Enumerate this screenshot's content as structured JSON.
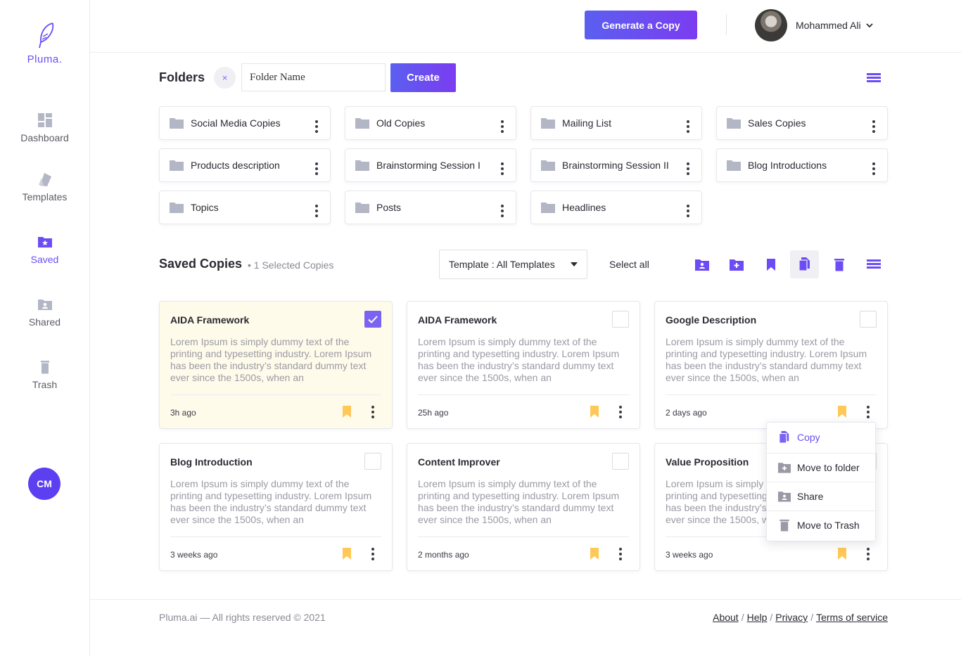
{
  "brand": {
    "name": "Pluma."
  },
  "sidebar": {
    "items": [
      {
        "label": "Dashboard",
        "icon": "dashboard-icon",
        "active": false
      },
      {
        "label": "Templates",
        "icon": "templates-icon",
        "active": false
      },
      {
        "label": "Saved",
        "icon": "saved-folder-icon",
        "active": true
      },
      {
        "label": "Shared",
        "icon": "shared-folder-icon",
        "active": false
      },
      {
        "label": "Trash",
        "icon": "trash-icon",
        "active": false
      }
    ],
    "avatar_initials": "CM"
  },
  "header": {
    "generate_label": "Generate a Copy",
    "user_name": "Mohammed Ali"
  },
  "folders_section": {
    "title": "Folders",
    "clear_label": "×",
    "input_value": "Folder Name",
    "create_label": "Create",
    "folders": [
      {
        "name": "Social Media Copies"
      },
      {
        "name": "Old Copies"
      },
      {
        "name": "Mailing List"
      },
      {
        "name": "Sales Copies"
      },
      {
        "name": "Products description"
      },
      {
        "name": "Brainstorming Session I"
      },
      {
        "name": "Brainstorming Session II"
      },
      {
        "name": "Blog Introductions"
      },
      {
        "name": "Topics"
      },
      {
        "name": "Posts"
      },
      {
        "name": "Headlines"
      }
    ]
  },
  "saved_section": {
    "title": "Saved Copies",
    "selected_text": "• 1 Selected Copies",
    "template_filter": "Template : All Templates",
    "select_all_label": "Select all",
    "toolbar_icons": [
      "share-folder-icon",
      "add-folder-icon",
      "bookmark-icon",
      "copy-icon",
      "trash-icon",
      "list-view-icon"
    ],
    "copies": [
      {
        "title": "AIDA Framework",
        "body": "Lorem Ipsum is simply dummy text of the printing and typesetting industry. Lorem Ipsum has been the industry’s standard dummy text ever since the 1500s, when an",
        "time": "3h ago",
        "checked": true
      },
      {
        "title": "AIDA Framework",
        "body": "Lorem Ipsum is simply dummy text of the printing and typesetting industry. Lorem Ipsum has been the industry’s standard dummy text ever since the 1500s, when an",
        "time": "25h ago",
        "checked": false
      },
      {
        "title": "Google Description",
        "body": "Lorem Ipsum is simply dummy text of the printing and typesetting industry. Lorem Ipsum has been the industry’s standard dummy text ever since the 1500s, when an",
        "time": "2 days ago",
        "checked": false
      },
      {
        "title": "Blog Introduction",
        "body": "Lorem Ipsum is simply dummy text of the printing and typesetting industry. Lorem Ipsum has been the industry’s standard dummy text ever since the 1500s, when an",
        "time": "3 weeks ago",
        "checked": false
      },
      {
        "title": "Content Improver",
        "body": "Lorem Ipsum is simply dummy text of the printing and typesetting industry. Lorem Ipsum has been the industry’s standard dummy text ever since the 1500s, when an",
        "time": "2 months ago",
        "checked": false
      },
      {
        "title": "Value Proposition",
        "body": "Lorem Ipsum is simply dummy text of the printing and typesetting industry. Lorem Ipsum has been the industry’s standard dummy text ever since the 1500s, when an",
        "time": "3 weeks ago",
        "checked": false
      }
    ]
  },
  "context_menu": {
    "items": [
      {
        "label": "Copy",
        "icon": "copy-icon",
        "active": true
      },
      {
        "label": "Move to folder",
        "icon": "move-folder-icon",
        "active": false
      },
      {
        "label": "Share",
        "icon": "share-folder-icon",
        "active": false
      },
      {
        "label": "Move to Trash",
        "icon": "trash-icon",
        "active": false
      }
    ]
  },
  "footer": {
    "copyright": "Pluma.ai — All rights reserved © 2021",
    "links": [
      "About",
      "Help",
      "Privacy",
      "Terms of service"
    ]
  },
  "colors": {
    "accent": "#6c4df5",
    "bookmark": "#ffc857",
    "selected_card_bg": "#fffbea",
    "folder_icon": "#b3b6c4"
  }
}
